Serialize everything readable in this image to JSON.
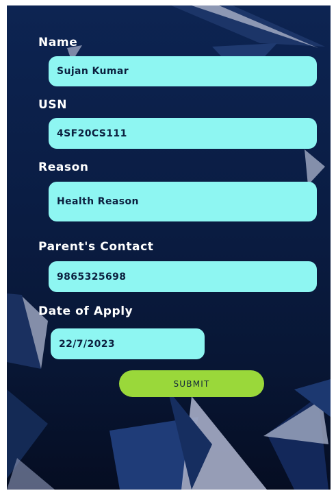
{
  "form": {
    "name": {
      "label": "Name",
      "value": "Sujan Kumar"
    },
    "usn": {
      "label": "USN",
      "value": "4SF20CS111"
    },
    "reason": {
      "label": "Reason",
      "value": "Health Reason"
    },
    "parent_contact": {
      "label": "Parent's Contact",
      "value": "9865325698"
    },
    "date_of_apply": {
      "label": "Date of Apply",
      "value": "22/7/2023"
    },
    "submit_label": "SUBMIT"
  },
  "colors": {
    "background": "#0a1c42",
    "field": "#8ef6f2",
    "submit": "#9ad83a",
    "label_text": "#ffffff"
  }
}
